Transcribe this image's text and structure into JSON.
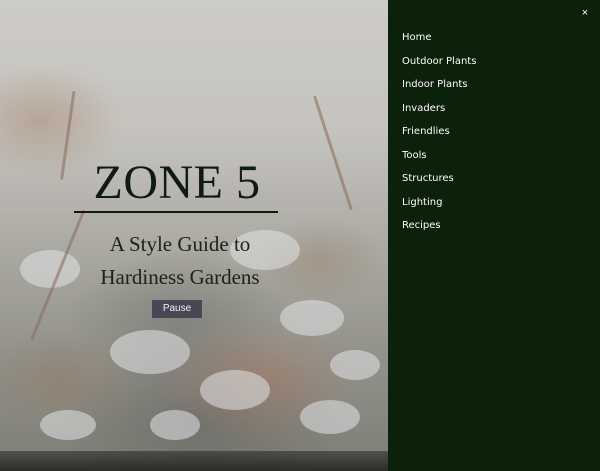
{
  "hero": {
    "title": "ZONE 5",
    "subtitle_line1": "A Style Guide to",
    "subtitle_line2": "Hardiness Gardens",
    "pause_label": "Pause"
  },
  "menu": {
    "close_label": "×",
    "items": [
      {
        "label": "Home"
      },
      {
        "label": "Outdoor Plants"
      },
      {
        "label": "Indoor Plants"
      },
      {
        "label": "Invaders"
      },
      {
        "label": "Friendlies"
      },
      {
        "label": "Tools"
      },
      {
        "label": "Structures"
      },
      {
        "label": "Lighting"
      },
      {
        "label": "Recipes"
      }
    ]
  },
  "colors": {
    "menu_background": "#0b2109",
    "menu_text": "#ffffff",
    "title_text": "#0f1a10",
    "pause_button": "#4a4655"
  }
}
